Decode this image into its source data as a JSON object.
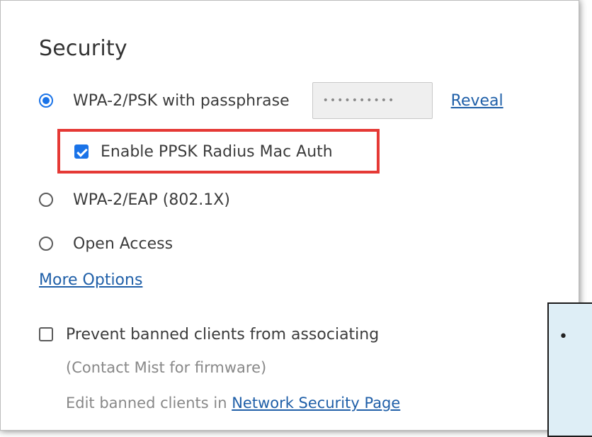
{
  "security": {
    "title": "Security",
    "options": {
      "wpa2_psk": {
        "label": "WPA-2/PSK with passphrase",
        "selected": true,
        "passphrase_masked": "••••••••••",
        "reveal_label": "Reveal"
      },
      "ppsk_radius": {
        "label": "Enable PPSK Radius Mac Auth",
        "checked": true
      },
      "wpa2_eap": {
        "label": "WPA-2/EAP (802.1X)",
        "selected": false
      },
      "open_access": {
        "label": "Open Access",
        "selected": false
      }
    },
    "more_options_label": "More Options",
    "prevent_banned": {
      "label": "Prevent banned clients from associating",
      "checked": false,
      "note": "(Contact Mist for firmware)",
      "edit_prefix": "Edit banned clients in ",
      "edit_link": "Network Security Page"
    }
  },
  "callout": {
    "bullet": "•"
  },
  "colors": {
    "accent": "#1a73e8",
    "link": "#1f5fa8",
    "highlight": "#e53935",
    "callout_bg": "#deeef6"
  },
  "icons": {
    "radio_selected": "radio-selected-icon",
    "radio_unselected": "radio-unselected-icon",
    "checkbox_checked": "checkbox-checked-icon",
    "checkbox_unchecked": "checkbox-unchecked-icon"
  }
}
